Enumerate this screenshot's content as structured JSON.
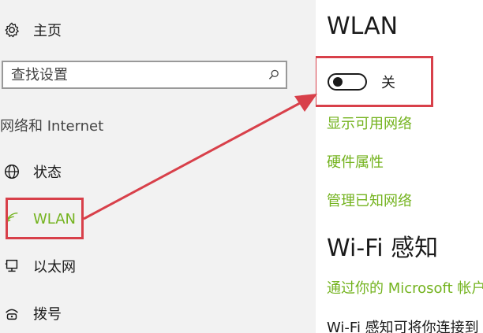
{
  "sidebar": {
    "home_label": "主页",
    "search_placeholder": "查找设置",
    "section_header": "网络和 Internet",
    "items": [
      {
        "label": "状态",
        "icon": "globe-icon"
      },
      {
        "label": "WLAN",
        "icon": "wifi-icon",
        "active": true
      },
      {
        "label": "以太网",
        "icon": "ethernet-icon"
      },
      {
        "label": "拨号",
        "icon": "dialup-icon"
      }
    ]
  },
  "main": {
    "title": "WLAN",
    "toggle": {
      "state": "off",
      "label": "关"
    },
    "links": [
      "显示可用网络",
      "硬件属性",
      "管理已知网络"
    ],
    "section_title": "Wi-Fi 感知",
    "section_link": "通过你的 Microsoft 帐户",
    "section_text": "Wi-Fi 感知可将你连接到"
  },
  "colors": {
    "accent_green": "#74b31f",
    "highlight_red": "#d8404a",
    "sidebar_bg": "#f2f2f2"
  }
}
